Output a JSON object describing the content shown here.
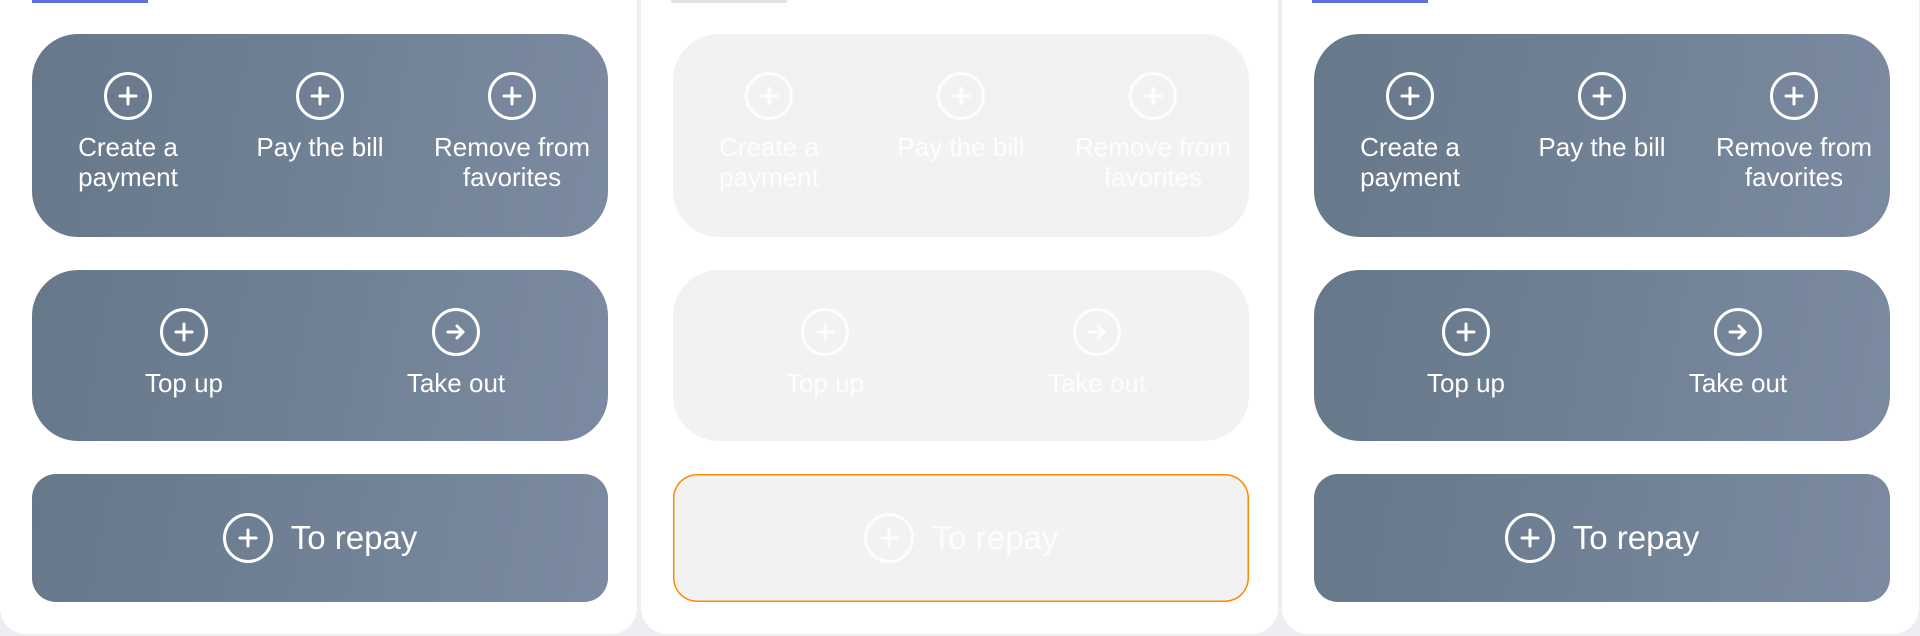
{
  "variants": [
    {
      "state": "default",
      "tab_color": "#5b6ee1",
      "top_actions": [
        {
          "label": "Create a payment",
          "icon": "plus-circle-icon"
        },
        {
          "label": "Pay the bill",
          "icon": "plus-circle-icon"
        },
        {
          "label": "Remove from favorites",
          "icon": "plus-circle-icon"
        }
      ],
      "mid_actions": [
        {
          "label": "Top up",
          "icon": "plus-circle-icon"
        },
        {
          "label": "Take out",
          "icon": "arrow-right-circle-icon"
        }
      ],
      "primary_action": {
        "label": "To repay",
        "icon": "plus-circle-icon"
      }
    },
    {
      "state": "disabled",
      "tab_color": "#dfe2e6",
      "top_actions": [
        {
          "label": "Create a payment",
          "icon": "plus-circle-icon"
        },
        {
          "label": "Pay the bill",
          "icon": "plus-circle-icon"
        },
        {
          "label": "Remove from favorites",
          "icon": "plus-circle-icon"
        }
      ],
      "mid_actions": [
        {
          "label": "Top up",
          "icon": "plus-circle-icon"
        },
        {
          "label": "Take out",
          "icon": "arrow-right-circle-icon"
        }
      ],
      "primary_action": {
        "label": "To repay",
        "icon": "plus-circle-icon"
      }
    },
    {
      "state": "default",
      "tab_color": "#5b6ee1",
      "top_actions": [
        {
          "label": "Create a payment",
          "icon": "plus-circle-icon"
        },
        {
          "label": "Pay the bill",
          "icon": "plus-circle-icon"
        },
        {
          "label": "Remove from favorites",
          "icon": "plus-circle-icon"
        }
      ],
      "mid_actions": [
        {
          "label": "Top up",
          "icon": "plus-circle-icon"
        },
        {
          "label": "Take out",
          "icon": "arrow-right-circle-icon"
        }
      ],
      "primary_action": {
        "label": "To repay",
        "icon": "plus-circle-icon"
      }
    }
  ],
  "colors": {
    "card_gradient_start": "#66788a",
    "card_gradient_end": "#7b8aa0",
    "disabled_card": "#f2f2f2",
    "accent": "#5b6ee1",
    "flag_outline": "#ff8a00"
  }
}
